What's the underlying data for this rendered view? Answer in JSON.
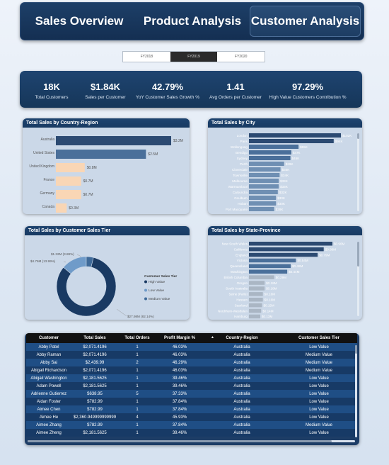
{
  "nav": {
    "tabs": [
      {
        "label": "Sales Overview",
        "active": false
      },
      {
        "label": "Product Analysis",
        "active": false
      },
      {
        "label": "Customer Analysis",
        "active": true
      }
    ]
  },
  "years": {
    "options": [
      "FY2018",
      "FY2019",
      "FY2020"
    ],
    "selected": "FY2019"
  },
  "kpis": [
    {
      "value": "18K",
      "label": "Total Customers"
    },
    {
      "value": "$1.84K",
      "label": "Sales per Customer"
    },
    {
      "value": "42.79%",
      "label": "YoY Customer Sales Growth %"
    },
    {
      "value": "1.41",
      "label": "Avg Orders per Customer"
    },
    {
      "value": "97.29%",
      "label": "High Value Customers Contribution %"
    }
  ],
  "colors": {
    "navy": "#1e4470",
    "dark_bar": "#2c4a72",
    "mid_bar": "#4a6f9a",
    "light_bar": "#6f8fb3",
    "peach": "#f9d6b5",
    "grey": "#aab6c4"
  },
  "panels": {
    "country": {
      "title": "Total Sales by Country-Region"
    },
    "city": {
      "title": "Total Sales by City"
    },
    "tier": {
      "title": "Total Sales by Customer Sales Tier"
    },
    "state": {
      "title": "Total Sales by State-Province"
    }
  },
  "chart_data": [
    {
      "type": "bar",
      "orientation": "horizontal",
      "title": "Total Sales by Country-Region",
      "categories": [
        "Australia",
        "United States",
        "United Kingdom",
        "France",
        "Germany",
        "Canada"
      ],
      "values": [
        3.2,
        2.5,
        0.8,
        0.7,
        0.7,
        0.3
      ],
      "labels": [
        "$3.2M",
        "$2.5M",
        "$0.8M",
        "$0.7M",
        "$0.7M",
        "$0.3M"
      ]
    },
    {
      "type": "bar",
      "orientation": "horizontal",
      "title": "Total Sales by City",
      "categories": [
        "London",
        "Paris",
        "Wollongong",
        "Bendigo",
        "Sydney",
        "Perth",
        "Cloverdale",
        "Townsville",
        "Melbourne",
        "Warrnambool",
        "Caloundra",
        "Goulburn",
        "Hobart",
        "Port Macquarie"
      ],
      "values": [
        102,
        94,
        55,
        47,
        46,
        39,
        35,
        34,
        33,
        33,
        32,
        30,
        30,
        28
      ],
      "labels": [
        "$102K",
        "$94K",
        "$55K",
        "$47K",
        "$46K",
        "$39K",
        "$35K",
        "$34K",
        "$33K",
        "$33K",
        "$32K",
        "$30K",
        "$30K",
        "$28K"
      ]
    },
    {
      "type": "pie",
      "title": "Total Sales by Customer Sales Tier",
      "legend_title": "Customer Sales Tier",
      "series": [
        {
          "name": "High Value",
          "value": 27.98,
          "label": "$27.98M (82.14%)",
          "color": "#1a3a63"
        },
        {
          "name": "Low Value",
          "value": 4.76,
          "label": "$4.76M (13.99%)",
          "color": "#6f9bc9"
        },
        {
          "name": "Medium Value",
          "value": 1.32,
          "label": "$1.32M (3.88%)",
          "color": "#3f6a99"
        }
      ]
    },
    {
      "type": "bar",
      "orientation": "horizontal",
      "title": "Total Sales by State-Province",
      "categories": [
        "New South Wales",
        "California",
        "England",
        "Victoria",
        "Queensland",
        "Washington",
        "British Columbia",
        "Oregon",
        "South Australia",
        "Seine (Paris)",
        "Hessen",
        "Saarland",
        "Nordrhein-Westfalen",
        "Hamburg"
      ],
      "values": [
        0.96,
        0.86,
        0.79,
        0.54,
        0.48,
        0.44,
        0.29,
        0.18,
        0.18,
        0.16,
        0.16,
        0.15,
        0.14,
        0.13
      ],
      "labels": [
        "$0.96M",
        "$0.86M",
        "$0.79M",
        "$0.54M",
        "$0.48M",
        "$0.44M",
        "$0.29M",
        "$0.18M",
        "$0.18M",
        "$0.16M",
        "$0.16M",
        "$0.15M",
        "$0.14M",
        "$0.13M"
      ]
    }
  ],
  "table": {
    "columns": [
      "Customer",
      "Total Sales",
      "Total Orders",
      "Profit Margin %",
      "Country-Region",
      "Customer Sales Tier"
    ],
    "rows": [
      [
        "Abby Patel",
        "$2,071.4196",
        "1",
        "46.03%",
        "Australia",
        "Low Value"
      ],
      [
        "Abby Raman",
        "$2,071.4196",
        "1",
        "46.03%",
        "Australia",
        "Medium Value"
      ],
      [
        "Abby Sai",
        "$2,439.99",
        "2",
        "46.29%",
        "Australia",
        "Medium Value"
      ],
      [
        "Abigail Richardson",
        "$2,071.4196",
        "1",
        "46.03%",
        "Australia",
        "Medium Value"
      ],
      [
        "Abigail Washington",
        "$2,181.5625",
        "1",
        "39.46%",
        "Australia",
        "Low Value"
      ],
      [
        "Adam Powell",
        "$2,181.5625",
        "1",
        "39.46%",
        "Australia",
        "Low Value"
      ],
      [
        "Adrienne Gutierrez",
        "$638.95",
        "5",
        "37.33%",
        "Australia",
        "Low Value"
      ],
      [
        "Aidan Foster",
        "$782.99",
        "1",
        "37.84%",
        "Australia",
        "Low Value"
      ],
      [
        "Aimee Chen",
        "$782.99",
        "1",
        "37.84%",
        "Australia",
        "Low Value"
      ],
      [
        "Aimee He",
        "$2,360.949999999999",
        "4",
        "45.93%",
        "Australia",
        "Low Value"
      ],
      [
        "Aimee Zhang",
        "$782.99",
        "1",
        "37.84%",
        "Australia",
        "Medium Value"
      ],
      [
        "Aimee Zheng",
        "$2,181.5625",
        "1",
        "39.46%",
        "Australia",
        "Low Value"
      ]
    ]
  }
}
